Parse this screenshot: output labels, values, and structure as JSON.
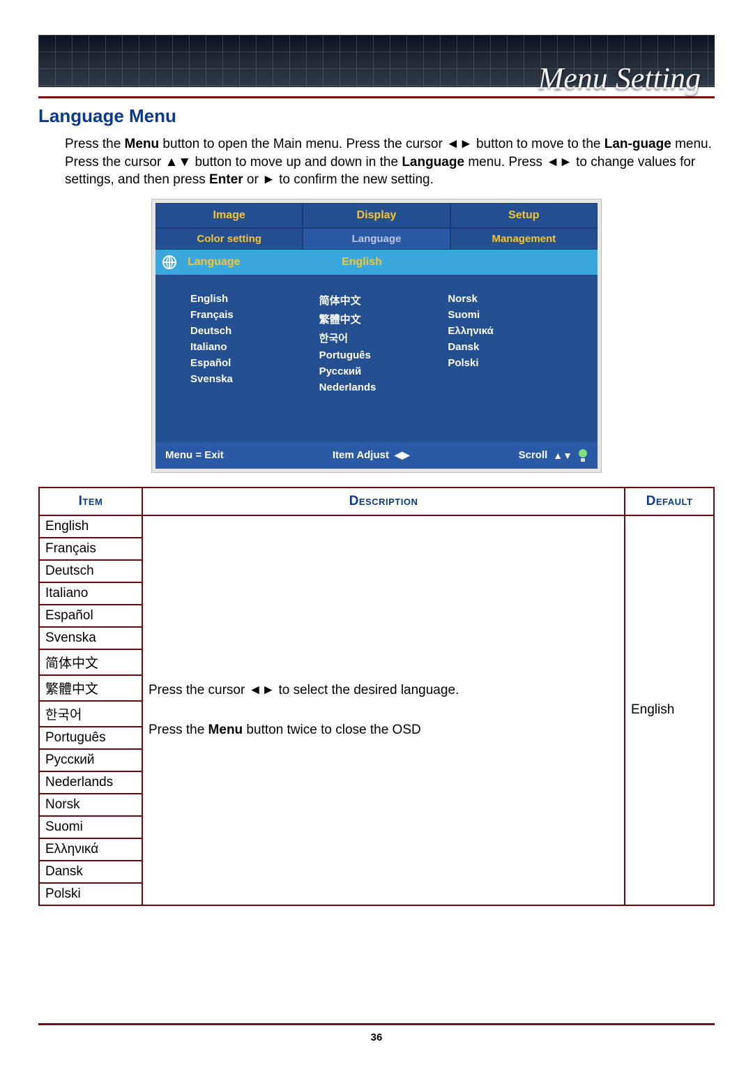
{
  "header": {
    "title": "Menu Setting"
  },
  "section": {
    "title": "Language Menu"
  },
  "intro": {
    "part1": "Press the ",
    "menu": "Menu",
    "part2": " button to open the Main menu. Press the cursor ◄► button to move to the ",
    "language_bold": "Lan-guage",
    "part3": " menu. Press the cursor ▲▼ button to move up and down in the ",
    "language_bold2": "Language",
    "part4": " menu. Press ◄► to change values for settings, and then press ",
    "enter": "Enter",
    "part5": " or ► to confirm the new setting."
  },
  "osd": {
    "tabs": [
      "Image",
      "Display",
      "Setup"
    ],
    "subtabs": [
      "Color setting",
      "Language",
      "Management"
    ],
    "selected": {
      "label": "Language",
      "value": "English"
    },
    "columns": [
      [
        "English",
        "Français",
        "Deutsch",
        "Italiano",
        "Español",
        "Svenska"
      ],
      [
        "简体中文",
        "繁體中文",
        "한국어",
        "Português",
        "Русский",
        "Nederlands"
      ],
      [
        "Norsk",
        "Suomi",
        "Ελληνικά",
        "Dansk",
        "Polski"
      ]
    ],
    "footer": {
      "menu_exit": "Menu = Exit",
      "item_adjust": "Item Adjust",
      "scroll": "Scroll"
    }
  },
  "table": {
    "headers": {
      "item": "Item",
      "description": "Description",
      "default": "Default"
    },
    "items": [
      "English",
      "Français",
      "Deutsch",
      "Italiano",
      "Español",
      "Svenska",
      "简体中文",
      "繁體中文",
      "한국어",
      "Português",
      "Русский",
      "Nederlands",
      "Norsk",
      "Suomi",
      "Ελληνικά",
      "Dansk",
      "Polski"
    ],
    "description": {
      "line1_pre": "Press the cursor ◄► to select the desired language.",
      "line2_pre": "Press the ",
      "line2_bold": "Menu",
      "line2_post": " button twice to close the OSD"
    },
    "default": "English"
  },
  "page_number": "36"
}
